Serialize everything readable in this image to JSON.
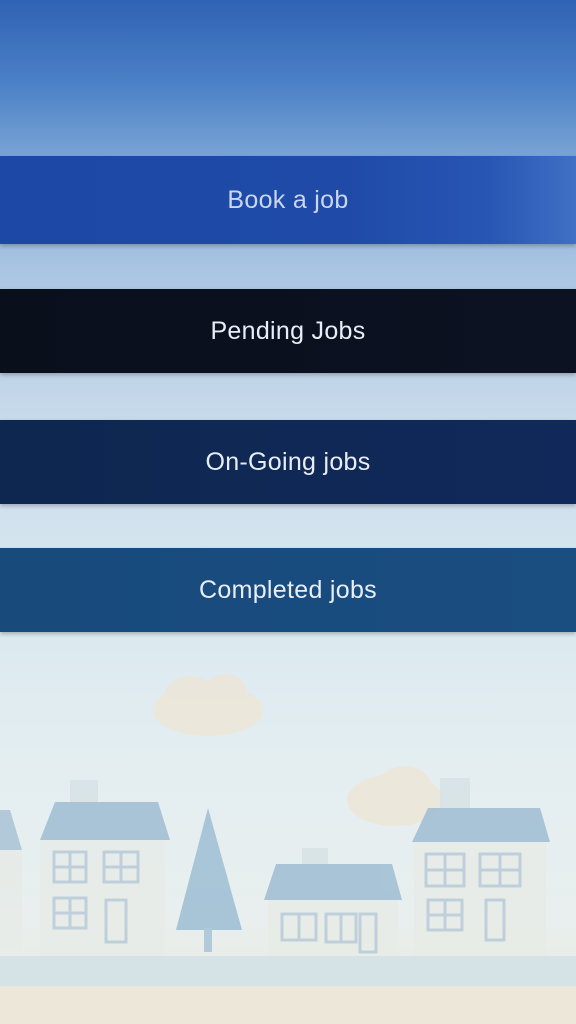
{
  "menu": {
    "book_label": "Book a job",
    "pending_label": "Pending Jobs",
    "ongoing_label": "On-Going jobs",
    "completed_label": "Completed jobs"
  },
  "colors": {
    "book": "#1f4aa8",
    "pending": "#0b1020",
    "ongoing": "#10285a",
    "completed": "#1a4c80"
  }
}
